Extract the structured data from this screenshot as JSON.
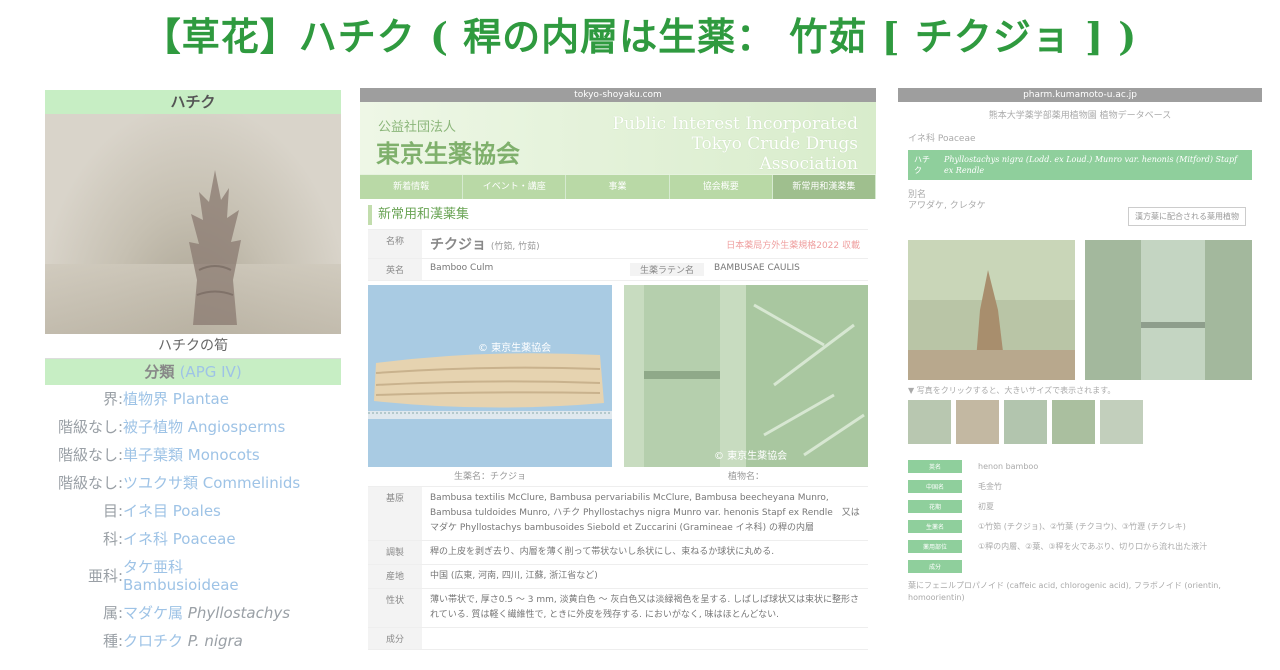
{
  "title": "【草花】ハチク ( 稈の内層は生薬： 竹茹 [ チクジョ ] )",
  "wiki": {
    "header": "ハチク",
    "caption": "ハチクの筍",
    "classification_label": "分類",
    "apg": "(APG IV)",
    "rows": [
      {
        "rank": "界:",
        "text": "植物界 Plantae"
      },
      {
        "rank": "階級なし:",
        "text": "被子植物 Angiosperms"
      },
      {
        "rank": "階級なし:",
        "text": "単子葉類 Monocots"
      },
      {
        "rank": "階級なし:",
        "text": "ツユクサ類 Commelinids"
      },
      {
        "rank": "目:",
        "text": "イネ目 Poales"
      },
      {
        "rank": "科:",
        "text": "イネ科 Poaceae"
      },
      {
        "rank": "亜科:",
        "text": "タケ亜科",
        "text2": "Bambusioideae"
      },
      {
        "rank": "属:",
        "text": "マダケ属",
        "italic": "Phyllostachys"
      },
      {
        "rank": "種:",
        "text": "クロチク",
        "italic": "P. nigra"
      }
    ]
  },
  "mid": {
    "url": "tokyo-shoyaku.com",
    "org": "公益社団法人",
    "name": "東京生薬協会",
    "en1": "Public Interest Incorporated",
    "en2": "Tokyo Crude Drugs",
    "en3": "Association",
    "nav": [
      "新着情報",
      "イベント・講座",
      "事業",
      "協会概要",
      "新常用和漢薬集"
    ],
    "section": "新常用和漢薬集",
    "name_key": "名称",
    "drug_name": "チクジョ",
    "drug_alt": "(竹筎, 竹茹)",
    "registry": "日本薬局方外生薬規格2022 収載",
    "en_key": "英名",
    "en_value": "Bamboo Culm",
    "latin_key": "生薬ラテン名",
    "latin_value": "BAMBUSAE CAULIS",
    "watermark": "© 東京生薬協会",
    "cap1": "生薬名：チクジョ",
    "cap2": "植物名：",
    "rows": [
      {
        "k": "基原",
        "v": "Bambusa textilis McClure, Bambusa pervariabilis McClure, Bambusa beecheyana Munro, Bambusa tuldoides Munro, ハチク Phyllostachys nigra Munro var. henonis Stapf ex Rendle　又はマダケ Phyllostachys bambusoides Siebold et Zuccarini (Gramineae イネ科) の稈の内層"
      },
      {
        "k": "調製",
        "v": "稈の上皮を剥ぎ去り、内層を薄く削って帯状ないし糸状にし、束ねるか球状に丸める."
      },
      {
        "k": "産地",
        "v": "中国 (広東, 河南, 四川, 江蘇, 浙江省など)"
      },
      {
        "k": "性状",
        "v": "薄い帯状で, 厚さ0.5 ～ 3 mm, 淡黄白色 ～ 灰白色又は淡緑褐色を呈する. しばしば球状又は束状に整形されている. 質は軽く繊維性で, ときに外皮を残存する. においがなく, 味はほとんどない."
      },
      {
        "k": "成分",
        "v": ""
      }
    ]
  },
  "right": {
    "url": "pharm.kumamoto-u.ac.jp",
    "sub": "熊本大学薬学部薬用植物園 植物データベース",
    "family": "イネ科 Poaceae",
    "bar_label": "ハチク",
    "bar_text": "Phyllostachys nigra (Lodd. ex Loud.) Munro var. henonis (Mitford) Stapf ex Rendle",
    "alias_label": "別名",
    "alias": "アワダケ, クレタケ",
    "button": "漢方薬に配合される薬用植物",
    "note": "▼ 写真をクリックすると、大きいサイズで表示されます。",
    "rows": [
      {
        "k": "英名",
        "v": "henon bamboo"
      },
      {
        "k": "中国名",
        "v": "毛金竹"
      },
      {
        "k": "花期",
        "v": "初夏"
      },
      {
        "k": "生薬名",
        "v": "①竹筎 (チクジョ)、②竹葉 (チクヨウ)、③竹瀝 (チクレキ)"
      },
      {
        "k": "薬用部位",
        "v": "①稈の内層、②葉、③稈を火であぶり、切り口から流れ出た液汁"
      },
      {
        "k": "成分",
        "v": ""
      }
    ],
    "component": "葉にフェニルプロパノイド (caffeic acid, chlorogenic acid), フラボノイド (orientin, homoorientin)"
  }
}
